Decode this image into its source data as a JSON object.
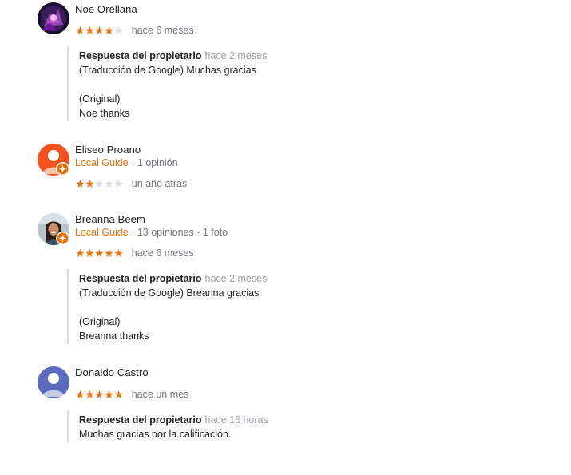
{
  "reviews": [
    {
      "name": "Noe Orellana",
      "rating": 4,
      "age": "hace 6 meses",
      "reply": {
        "owner_label": "Respuesta del propietario",
        "age": "hace 2 meses",
        "translated": "(Traducción de Google) Muchas gracias",
        "original_label": "(Original)",
        "original": "Noe thanks"
      }
    },
    {
      "name": "Eliseo Proano",
      "local_guide": "Local Guide",
      "stats": "· 1 opinión",
      "rating": 2,
      "age": "un año atrás",
      "avatar_color": "#f4511e"
    },
    {
      "name": "Breanna Beem",
      "local_guide": "Local Guide",
      "stats": "· 13 opiniones · 1 foto",
      "rating": 5,
      "age": "hace 6 meses",
      "reply": {
        "owner_label": "Respuesta del propietario",
        "age": "hace 2 meses",
        "translated": "(Traducción de Google) Breanna gracias",
        "original_label": "(Original)",
        "original": "Breanna thanks"
      }
    },
    {
      "name": "Donaldo Castro",
      "rating": 5,
      "age": "hace un mes",
      "avatar_color": "#5c6bc0",
      "reply": {
        "owner_label": "Respuesta del propietario",
        "age": "hace 16 horas",
        "text": "Muchas gracias por la calificación."
      }
    }
  ],
  "colors": {
    "accent": "#e8710a",
    "star_off": "#dadce0",
    "muted": "#70757a",
    "reply_bar": "#dadce0"
  }
}
